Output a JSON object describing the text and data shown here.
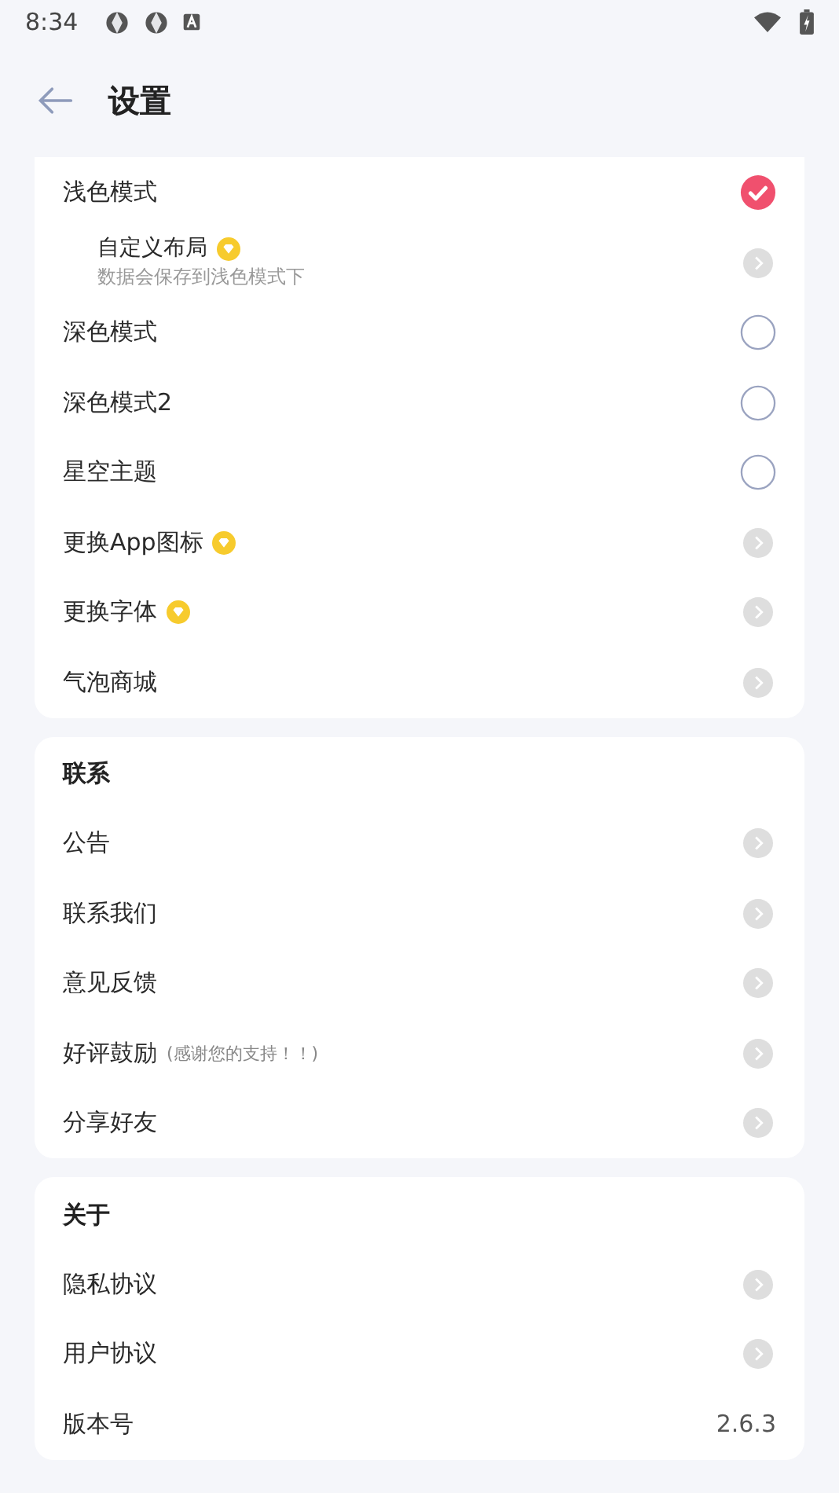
{
  "status_bar": {
    "time": "8:34"
  },
  "header": {
    "title": "设置"
  },
  "sections": [
    {
      "items": [
        {
          "kind": "radio",
          "label": "浅色模式",
          "selected": true
        },
        {
          "kind": "sub",
          "label": "自定义布局",
          "premium": true,
          "subtitle": "数据会保存到浅色模式下"
        },
        {
          "kind": "radio",
          "label": "深色模式",
          "selected": false
        },
        {
          "kind": "radio",
          "label": "深色模式2",
          "selected": false
        },
        {
          "kind": "radio",
          "label": "星空主题",
          "selected": false
        },
        {
          "kind": "nav",
          "label": "更换App图标",
          "premium": true
        },
        {
          "kind": "nav",
          "label": "更换字体",
          "premium": true
        },
        {
          "kind": "nav",
          "label": "气泡商城",
          "premium": false
        }
      ]
    },
    {
      "title": "联系",
      "items": [
        {
          "kind": "nav",
          "label": "公告",
          "premium": false
        },
        {
          "kind": "nav",
          "label": "联系我们",
          "premium": false
        },
        {
          "kind": "nav",
          "label": "意见反馈",
          "premium": false
        },
        {
          "kind": "nav",
          "label": "好评鼓励",
          "note": "(感谢您的支持！！)",
          "premium": false
        },
        {
          "kind": "nav",
          "label": "分享好友",
          "premium": false
        }
      ]
    },
    {
      "title": "关于",
      "items": [
        {
          "kind": "nav",
          "label": "隐私协议",
          "premium": false
        },
        {
          "kind": "nav",
          "label": "用户协议",
          "premium": false
        },
        {
          "kind": "value",
          "label": "版本号",
          "value": "2.6.3"
        }
      ]
    }
  ]
}
